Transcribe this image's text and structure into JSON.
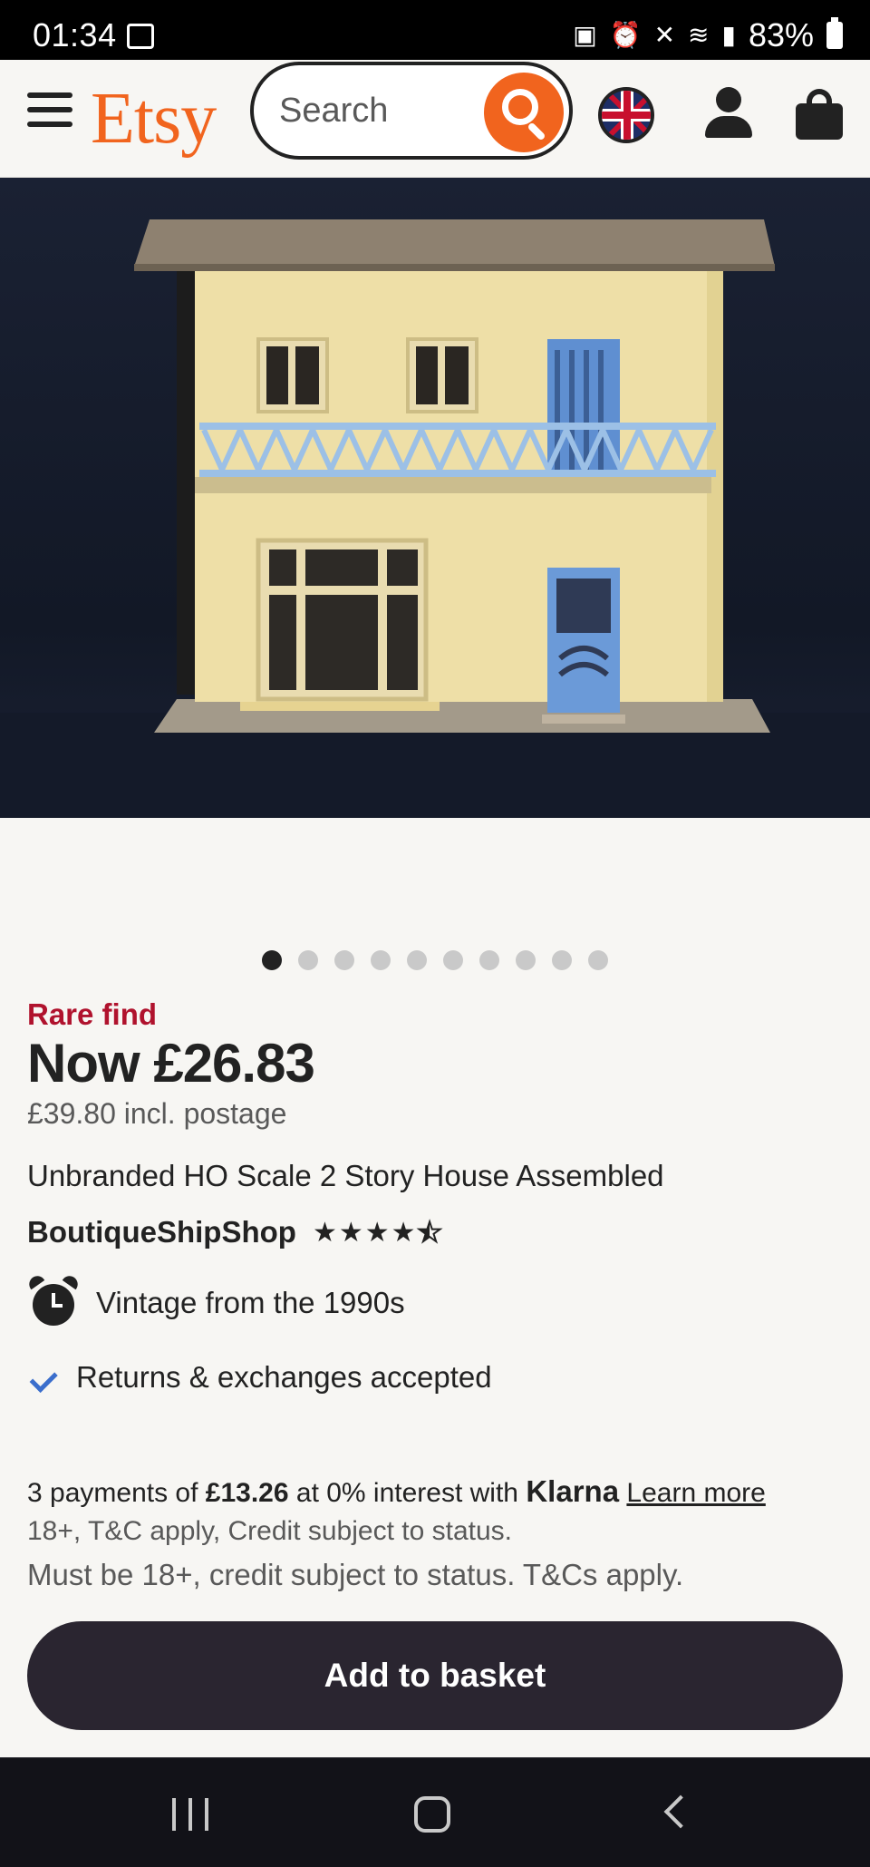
{
  "status_bar": {
    "time": "01:34",
    "battery": "83%"
  },
  "header": {
    "logo": "Etsy",
    "search_placeholder": "Search",
    "icons": [
      "menu-icon",
      "search-icon",
      "uk-flag-icon",
      "account-icon",
      "basket-icon"
    ]
  },
  "gallery": {
    "image_count": 10,
    "active_index": 0
  },
  "product": {
    "badge": "Rare find",
    "price": "Now £26.83",
    "postage_price": "£39.80 incl. postage",
    "title": "Unbranded HO Scale 2 Story House Assembled",
    "shop_name": "BoutiqueShipShop",
    "rating_stars": 4.5,
    "vintage": "Vintage from the 1990s",
    "returns": "Returns & exchanges accepted"
  },
  "klarna": {
    "prefix": "3 payments of ",
    "amount": "£13.26",
    "middle": " at 0% interest with ",
    "brand": "Klarna",
    "learn_more": "Learn more",
    "terms": "18+, T&C apply, Credit subject to status.",
    "notice": "Must be 18+, credit subject to status. T&Cs apply."
  },
  "actions": {
    "add_to_basket": "Add to basket"
  },
  "colors": {
    "brand": "#f1641e",
    "rare_find": "#b0122d",
    "check": "#3b6ecc",
    "button": "#2a2530"
  }
}
